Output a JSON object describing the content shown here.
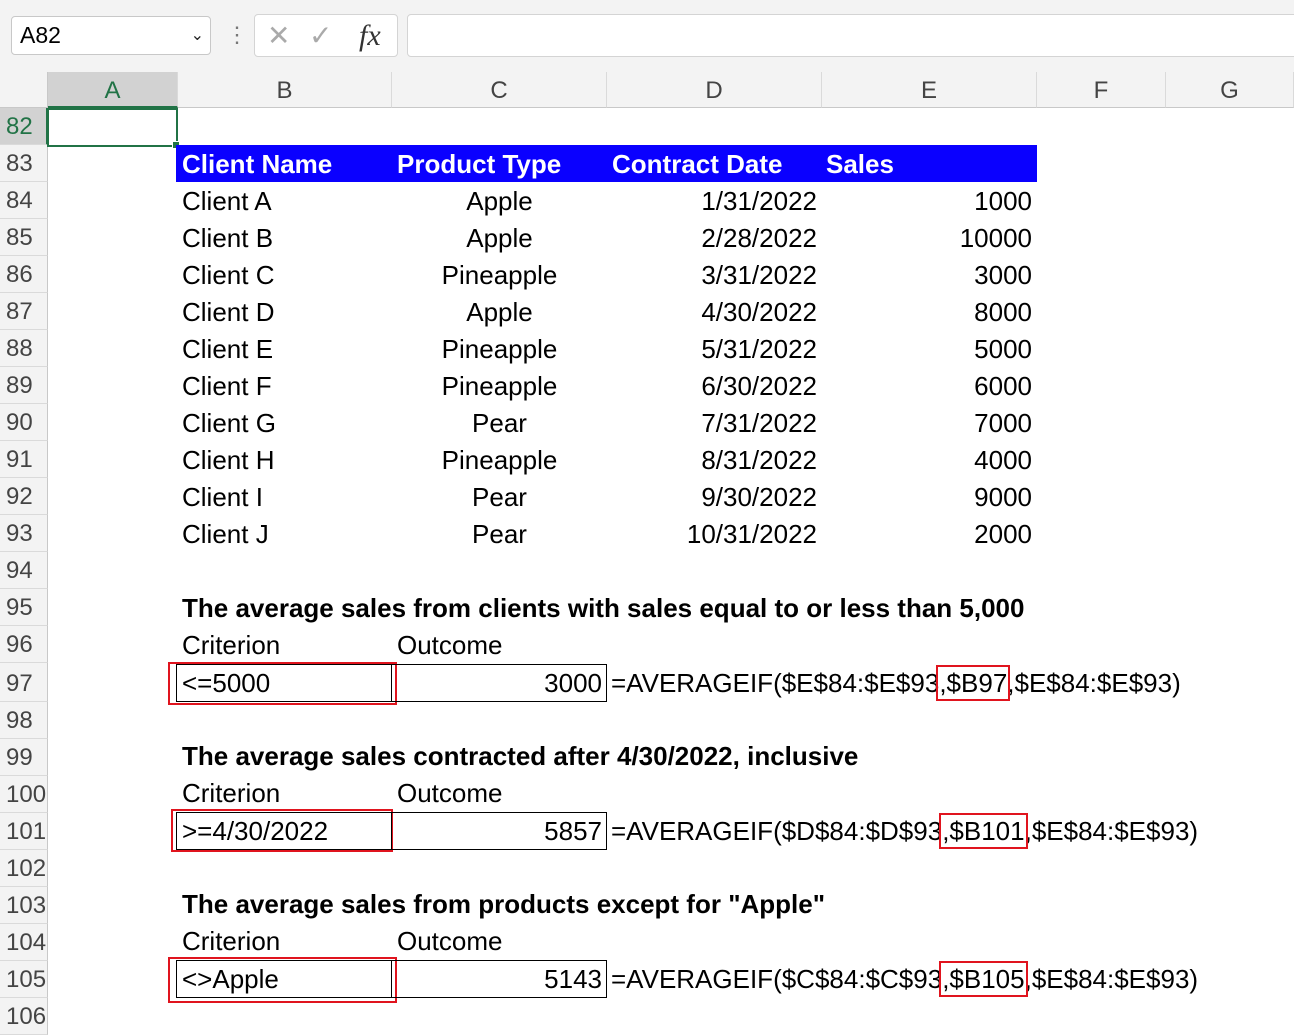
{
  "name_box": {
    "value": "A82"
  },
  "formula_bar": {
    "value": ""
  },
  "columns": [
    "A",
    "B",
    "C",
    "D",
    "E",
    "F",
    "G"
  ],
  "rows": [
    "82",
    "83",
    "84",
    "85",
    "86",
    "87",
    "88",
    "89",
    "90",
    "91",
    "92",
    "93",
    "94",
    "95",
    "96",
    "97",
    "98",
    "99",
    "100",
    "101",
    "102",
    "103",
    "104",
    "105",
    "106"
  ],
  "selected_cell": "A82",
  "table": {
    "header_fill": "#0a00ff",
    "headers": [
      "Client Name",
      "Product Type",
      "Contract Date",
      "Sales"
    ],
    "rows": [
      [
        "Client A",
        "Apple",
        "1/31/2022",
        "1000"
      ],
      [
        "Client B",
        "Apple",
        "2/28/2022",
        "10000"
      ],
      [
        "Client C",
        "Pineapple",
        "3/31/2022",
        "3000"
      ],
      [
        "Client D",
        "Apple",
        "4/30/2022",
        "8000"
      ],
      [
        "Client E",
        "Pineapple",
        "5/31/2022",
        "5000"
      ],
      [
        "Client F",
        "Pineapple",
        "6/30/2022",
        "6000"
      ],
      [
        "Client G",
        "Pear",
        "7/31/2022",
        "7000"
      ],
      [
        "Client H",
        "Pineapple",
        "8/31/2022",
        "4000"
      ],
      [
        "Client I",
        "Pear",
        "9/30/2022",
        "9000"
      ],
      [
        "Client J",
        "Pear",
        "10/31/2022",
        "2000"
      ]
    ]
  },
  "examples": [
    {
      "title": "The average sales from clients with sales equal to or less than 5,000",
      "criterion_label": "Criterion",
      "outcome_label": "Outcome",
      "criterion": "<=5000",
      "outcome": "3000",
      "formula_pre": "=AVERAGEIF($E$84:$E$93",
      "formula_ref": ",$B97",
      "formula_post": ",$E$84:$E$93)"
    },
    {
      "title": "The average sales contracted after 4/30/2022, inclusive",
      "criterion_label": "Criterion",
      "outcome_label": "Outcome",
      "criterion": ">=4/30/2022",
      "outcome": "5857",
      "formula_pre": "=AVERAGEIF($D$84:$D$93",
      "formula_ref": ",$B101",
      "formula_post": ",$E$84:$E$93)"
    },
    {
      "title": "The average sales from products except for \"Apple\"",
      "criterion_label": "Criterion",
      "outcome_label": "Outcome",
      "criterion": "<>Apple",
      "outcome": "5143",
      "formula_pre": "=AVERAGEIF($C$84:$C$93",
      "formula_ref": ",$B105",
      "formula_post": ",$E$84:$E$93)"
    }
  ],
  "colors": {
    "selection": "#217346",
    "highlight_border": "#e0141e"
  }
}
